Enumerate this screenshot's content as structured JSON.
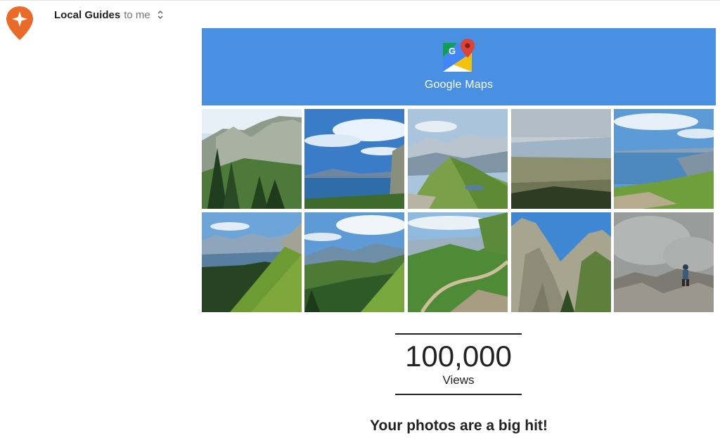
{
  "email": {
    "sender": "Local Guides",
    "recipient": "to me",
    "avatar_icon": "local-guides-star-pin-icon",
    "expand_icon": "expand-details-icon"
  },
  "banner": {
    "background_color": "#4a90e2",
    "icon": "google-maps-icon",
    "brand": "Google Maps"
  },
  "photos": {
    "count": 10,
    "subjects": [
      "mountain-cliffs-forest",
      "lake-under-blue-sky",
      "green-ridge-valley",
      "lake-plain-view",
      "lake-shore-meadow",
      "lake-from-grassy-slope",
      "forested-hills",
      "mountain-trail",
      "rocky-peaks",
      "hiker-on-rocks-in-fog"
    ]
  },
  "stats": {
    "number": "100,000",
    "label": "Views"
  },
  "headline": "Your photos are a big hit!"
}
